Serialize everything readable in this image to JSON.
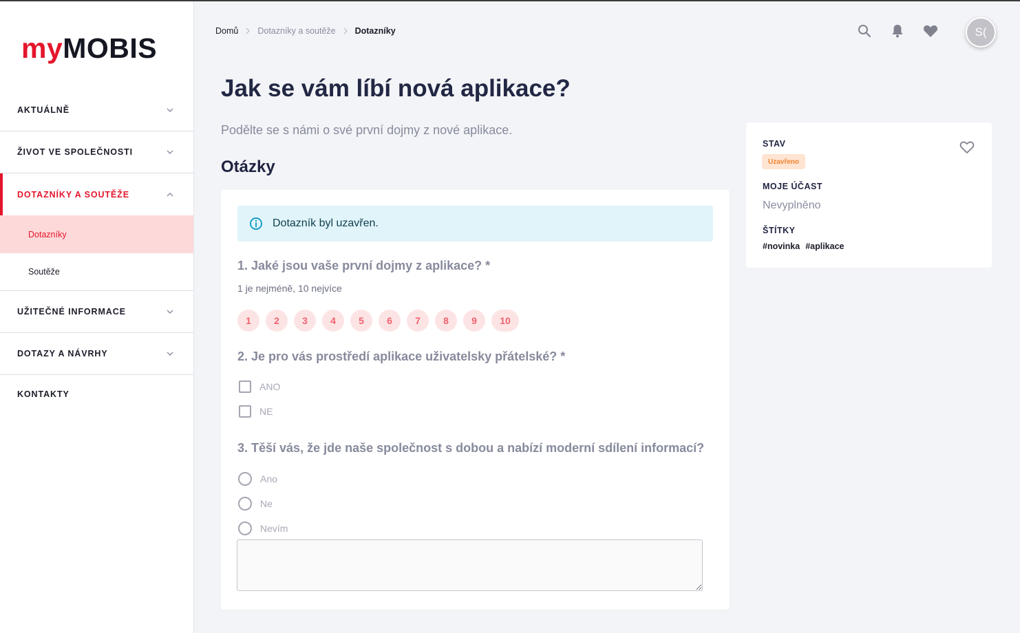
{
  "logo": {
    "part1": "my",
    "part2": "MOBIS"
  },
  "sidebar": {
    "items": [
      {
        "label": "AKTUÁLNĚ"
      },
      {
        "label": "ŽIVOT VE SPOLEČNOSTI"
      },
      {
        "label": "DOTAZNÍKY A SOUTĚŽE",
        "active": true,
        "subitems": [
          {
            "label": "Dotazníky",
            "selected": true
          },
          {
            "label": "Soutěže"
          }
        ]
      },
      {
        "label": "UŽITEČNÉ INFORMACE"
      },
      {
        "label": "DOTAZY A NÁVRHY"
      },
      {
        "label": "KONTAKTY"
      }
    ]
  },
  "breadcrumb": [
    "Domů",
    "Dotazníky a soutěže",
    "Dotazníky"
  ],
  "header": {
    "icons": [
      "search-icon",
      "bell-icon",
      "heart-icon"
    ],
    "avatar_initials": "S("
  },
  "page": {
    "title": "Jak se vám líbí nová aplikace?",
    "description": "Podělte se s námi o své první dojmy z nové aplikace.",
    "section_title": "Otázky"
  },
  "survey": {
    "info": "Dotazník byl uzavřen.",
    "q1": {
      "title": "1. Jaké jsou vaše první dojmy z aplikace? *",
      "hint": "1 je nejméně, 10 nejvíce",
      "scale": [
        "1",
        "2",
        "3",
        "4",
        "5",
        "6",
        "7",
        "8",
        "9",
        "10"
      ]
    },
    "q2": {
      "title": "2. Je pro vás prostředí aplikace uživatelsky přátelské? *",
      "options": [
        "ANO",
        "NE"
      ]
    },
    "q3": {
      "title": "3. Těší vás, že jde naše společnost s dobou a nabízí moderní sdílení informací?",
      "options": [
        "Ano",
        "Ne",
        "Nevím"
      ],
      "textarea_value": ""
    }
  },
  "side_panel": {
    "status_label": "STAV",
    "status_badge": "Uzavřeno",
    "participation_label": "MOJE ÚČAST",
    "participation_value": "Nevyplněno",
    "tags_label": "ŠTÍTKY",
    "tags": [
      "#novinka",
      "#aplikace"
    ]
  },
  "colors": {
    "brand_red": "#e4162c",
    "title_navy": "#222744",
    "info_bg": "#e0f4fa",
    "badge_bg": "#ffe4d2",
    "badge_text": "#f0842e",
    "scale_bg": "#fde4e4",
    "scale_text": "#f06270"
  }
}
